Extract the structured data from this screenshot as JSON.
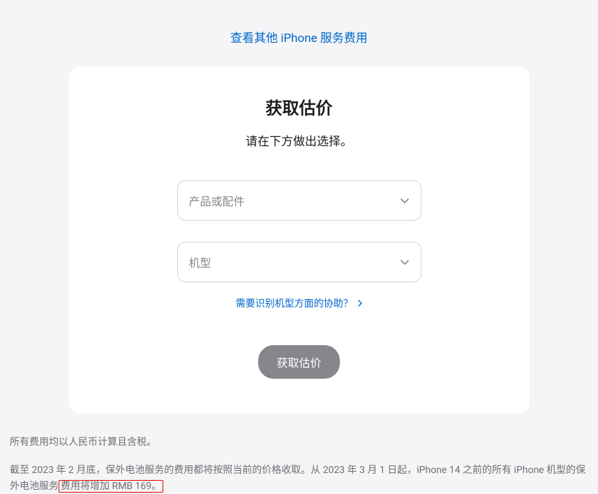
{
  "topLink": {
    "label": "查看其他 iPhone 服务费用"
  },
  "card": {
    "title": "获取估价",
    "subtitle": "请在下方做出选择。",
    "select1": {
      "placeholder": "产品或配件"
    },
    "select2": {
      "placeholder": "机型"
    },
    "helpLink": {
      "label": "需要识别机型方面的协助？"
    },
    "submitButton": {
      "label": "获取估价"
    }
  },
  "footer": {
    "line1": "所有费用均以人民币计算且含税。",
    "line2_part1": "截至 2023 年 2 月底，保外电池服务的费用都将按照当前的价格收取。从 2023 年 3 月 1 日起，iPhone 14 之前的所有 iPhone 机型的保外电池服务",
    "line2_part2": "费用将增加 RMB 169。"
  }
}
